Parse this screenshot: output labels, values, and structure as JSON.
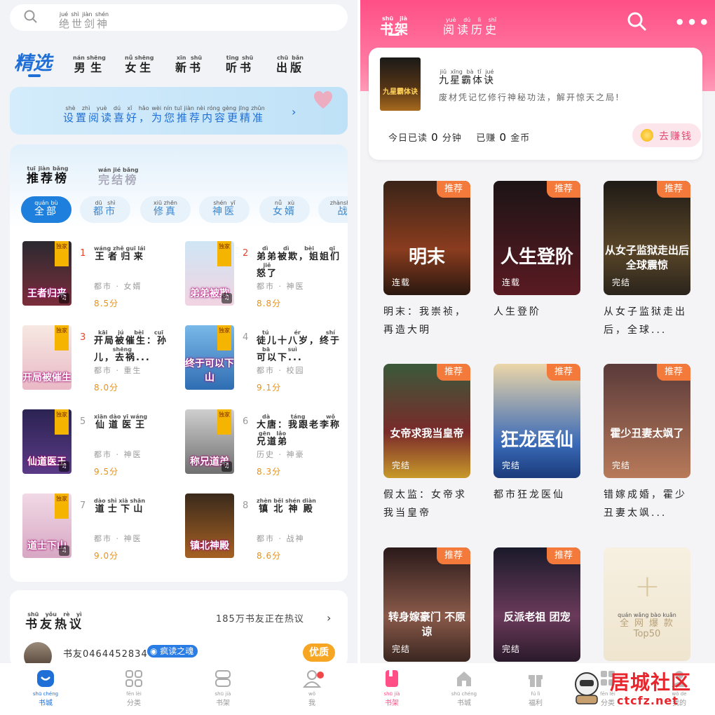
{
  "left": {
    "search": {
      "placeholder": "绝世剑神",
      "placeholder_py": "jué shì jiàn shén"
    },
    "cat_tabs": {
      "selected": "精选",
      "items": [
        {
          "label": "男生",
          "py": "nán shēng"
        },
        {
          "label": "女生",
          "py": "nǚ shēng"
        },
        {
          "label": "新书",
          "py": "xīn shū"
        },
        {
          "label": "听书",
          "py": "tīng shū"
        },
        {
          "label": "出版",
          "py": "chū bǎn"
        }
      ]
    },
    "banner": {
      "text1": "设置阅读喜好，",
      "text1_py": "shè zhì yuè dú xǐ hǎo",
      "text2": "为您推荐内容更精准",
      "text2_py": "wèi nín tuī jiàn nèi róng gèng jīng zhǔn"
    },
    "rank": {
      "tab_active": "推荐榜",
      "tab_active_py": "tuī jiàn bǎng",
      "tab_other": "完结榜",
      "tab_other_py": "wán jié bǎng",
      "chips": [
        {
          "label": "全部",
          "py": "quán bù"
        },
        {
          "label": "都市",
          "py": "dū shì"
        },
        {
          "label": "修真",
          "py": "xiū zhēn"
        },
        {
          "label": "神医",
          "py": "shén yī"
        },
        {
          "label": "女婿",
          "py": "nǚ xù"
        },
        {
          "label": "战",
          "py": "zhànshén"
        }
      ],
      "books": [
        {
          "num": "1",
          "title": "王者归来",
          "py": "wáng zhě guī lái",
          "tags": "都市 · 女婿",
          "score": "8.5分",
          "cover_text": "王者归来",
          "exclusive": "独家",
          "audio": true
        },
        {
          "num": "2",
          "title": "弟弟被欺，姐姐们怒了",
          "py": "dì dì bèi qī jiě",
          "tags": "都市 · 神医",
          "score": "8.8分",
          "cover_text": "弟弟被欺",
          "exclusive": "独家",
          "audio": true
        },
        {
          "num": "3",
          "title": "开局被催生：孙儿，去祸...",
          "py": "kāi jú bèi cuī shēng",
          "tags": "都市 · 重生",
          "score": "8.0分",
          "cover_text": "开局被催生",
          "exclusive": "独家",
          "audio": false
        },
        {
          "num": "4",
          "title": "徒儿十八岁，终于可以下...",
          "py": "tú ér shí bā suì",
          "tags": "都市 · 校园",
          "score": "9.1分",
          "cover_text": "终于可以下山",
          "exclusive": "独家",
          "audio": false
        },
        {
          "num": "5",
          "title": "仙道医王",
          "py": "xiān dào yī wáng",
          "tags": "都市 · 神医",
          "score": "9.5分",
          "cover_text": "仙道医王",
          "exclusive": "独家",
          "audio": true
        },
        {
          "num": "6",
          "title": "大唐：我跟老李称兄道弟",
          "py": "dà táng wǒ gēn lǎo",
          "tags": "历史 · 神豪",
          "score": "8.3分",
          "cover_text": "称兄道弟",
          "exclusive": "独家",
          "audio": true
        },
        {
          "num": "7",
          "title": "道士下山",
          "py": "dào shì xià shān",
          "tags": "都市 · 神医",
          "score": "9.0分",
          "cover_text": "道士下山",
          "exclusive": "独家",
          "audio": true
        },
        {
          "num": "8",
          "title": "镇北神殿",
          "py": "zhèn běi shén diàn",
          "tags": "都市 · 战神",
          "score": "8.6分",
          "cover_text": "镇北神殿",
          "exclusive": "",
          "audio": false
        }
      ]
    },
    "discussion": {
      "title": "书友热议",
      "title_py": "shū yǒu rè yì",
      "count": "185万书友正在热议",
      "user": "书友0464452834",
      "badge": "疯读之魂",
      "quality": "优质"
    },
    "nav": [
      {
        "label": "书城",
        "py": "shū chéng"
      },
      {
        "label": "分类",
        "py": "fēn lèi"
      },
      {
        "label": "书架",
        "py": "shū jià"
      },
      {
        "label": "我",
        "py": "wǒ"
      }
    ]
  },
  "right": {
    "tabs": {
      "shelf": "书架",
      "shelf_py": "shū jià",
      "history": "阅读历史",
      "history_py": "yuè dú lì shǐ"
    },
    "recent": {
      "title": "九星霸体诀",
      "title_py": "jiǔ xīng bà tǐ jué",
      "desc": "废材凭记忆修行神秘功法，解开惊天之局!",
      "today_read_label": "今日已读",
      "today_read_value": "0",
      "today_read_unit": "分钟",
      "earned_label": "已赚",
      "earned_value": "0",
      "earned_unit": "金币",
      "earn_button": "去赚钱",
      "cover_text": "九星霸体诀"
    },
    "shelf": [
      {
        "title": "明末：我崇祯，再造大明",
        "tag": "推荐",
        "status": "连载",
        "cover_text": "明末"
      },
      {
        "title": "人生登阶",
        "tag": "推荐",
        "status": "连载",
        "cover_text": "人生登阶"
      },
      {
        "title": "从女子监狱走出后，全球...",
        "tag": "推荐",
        "status": "完结",
        "cover_text": "从女子监狱走出后 全球震惊"
      },
      {
        "title": "假太监：女帝求我当皇帝",
        "tag": "推荐",
        "status": "完结",
        "cover_text": "女帝求我当皇帝"
      },
      {
        "title": "都市狂龙医仙",
        "tag": "推荐",
        "status": "完结",
        "cover_text": "狂龙医仙"
      },
      {
        "title": "错嫁成婚，霍少丑妻太飒...",
        "tag": "推荐",
        "status": "完结",
        "cover_text": "霍少丑妻太飒了"
      },
      {
        "title": "",
        "tag": "推荐",
        "status": "完结",
        "cover_text": "转身嫁豪门 不原谅"
      },
      {
        "title": "",
        "tag": "推荐",
        "status": "完结",
        "cover_text": "反派老祖 团宠"
      }
    ],
    "add_card": {
      "line1": "全网爆款",
      "line1_py": "quán wǎng bào kuǎn",
      "line2": "Top50"
    },
    "nav": [
      {
        "label": "书架",
        "py": "shū jià"
      },
      {
        "label": "书城",
        "py": "shū chéng"
      },
      {
        "label": "福利",
        "py": "fú lì"
      },
      {
        "label": "分类",
        "py": "fēn lèi"
      },
      {
        "label": "我的",
        "py": "wǒ de"
      }
    ],
    "watermark": {
      "line1": "居城社区",
      "line2": "ctcfz.net"
    }
  }
}
